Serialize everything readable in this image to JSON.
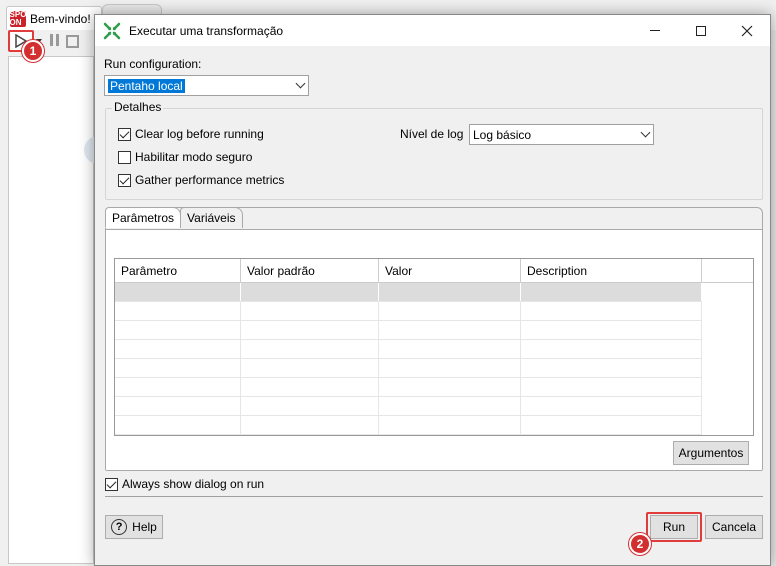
{
  "background": {
    "tab_label": "Bem-vindo!",
    "app_icon_text": "SPO ON"
  },
  "annotations": {
    "badge_1": "1",
    "badge_2": "2",
    "highlight_color": "#e03c3c"
  },
  "dialog": {
    "title": "Executar uma transformação",
    "run_configuration_label": "Run configuration:",
    "run_configuration_value": "Pentaho local",
    "details_group": "Detalhes",
    "checkboxes": [
      {
        "label": "Clear log before running",
        "checked": true
      },
      {
        "label": "Habilitar modo seguro",
        "checked": false
      },
      {
        "label": "Gather performance metrics",
        "checked": true
      }
    ],
    "log_level_label": "Nível de log",
    "log_level_value": "Log básico",
    "tabs": [
      {
        "label": "Parâmetros",
        "active": true
      },
      {
        "label": "Variáveis",
        "active": false
      }
    ],
    "grid_columns": [
      "Parâmetro",
      "Valor padrão",
      "Valor",
      "Description",
      ""
    ],
    "grid_rows": [
      [
        "",
        "",
        "",
        "",
        ""
      ],
      [
        "",
        "",
        "",
        "",
        ""
      ],
      [
        "",
        "",
        "",
        "",
        ""
      ],
      [
        "",
        "",
        "",
        "",
        ""
      ],
      [
        "",
        "",
        "",
        "",
        ""
      ],
      [
        "",
        "",
        "",
        "",
        ""
      ],
      [
        "",
        "",
        "",
        "",
        ""
      ],
      [
        "",
        "",
        "",
        "",
        ""
      ]
    ],
    "arguments_button": "Argumentos",
    "always_show_label": "Always show dialog on run",
    "always_show_checked": true,
    "help_button": "Help",
    "run_button": "Run",
    "cancel_button": "Cancela"
  }
}
